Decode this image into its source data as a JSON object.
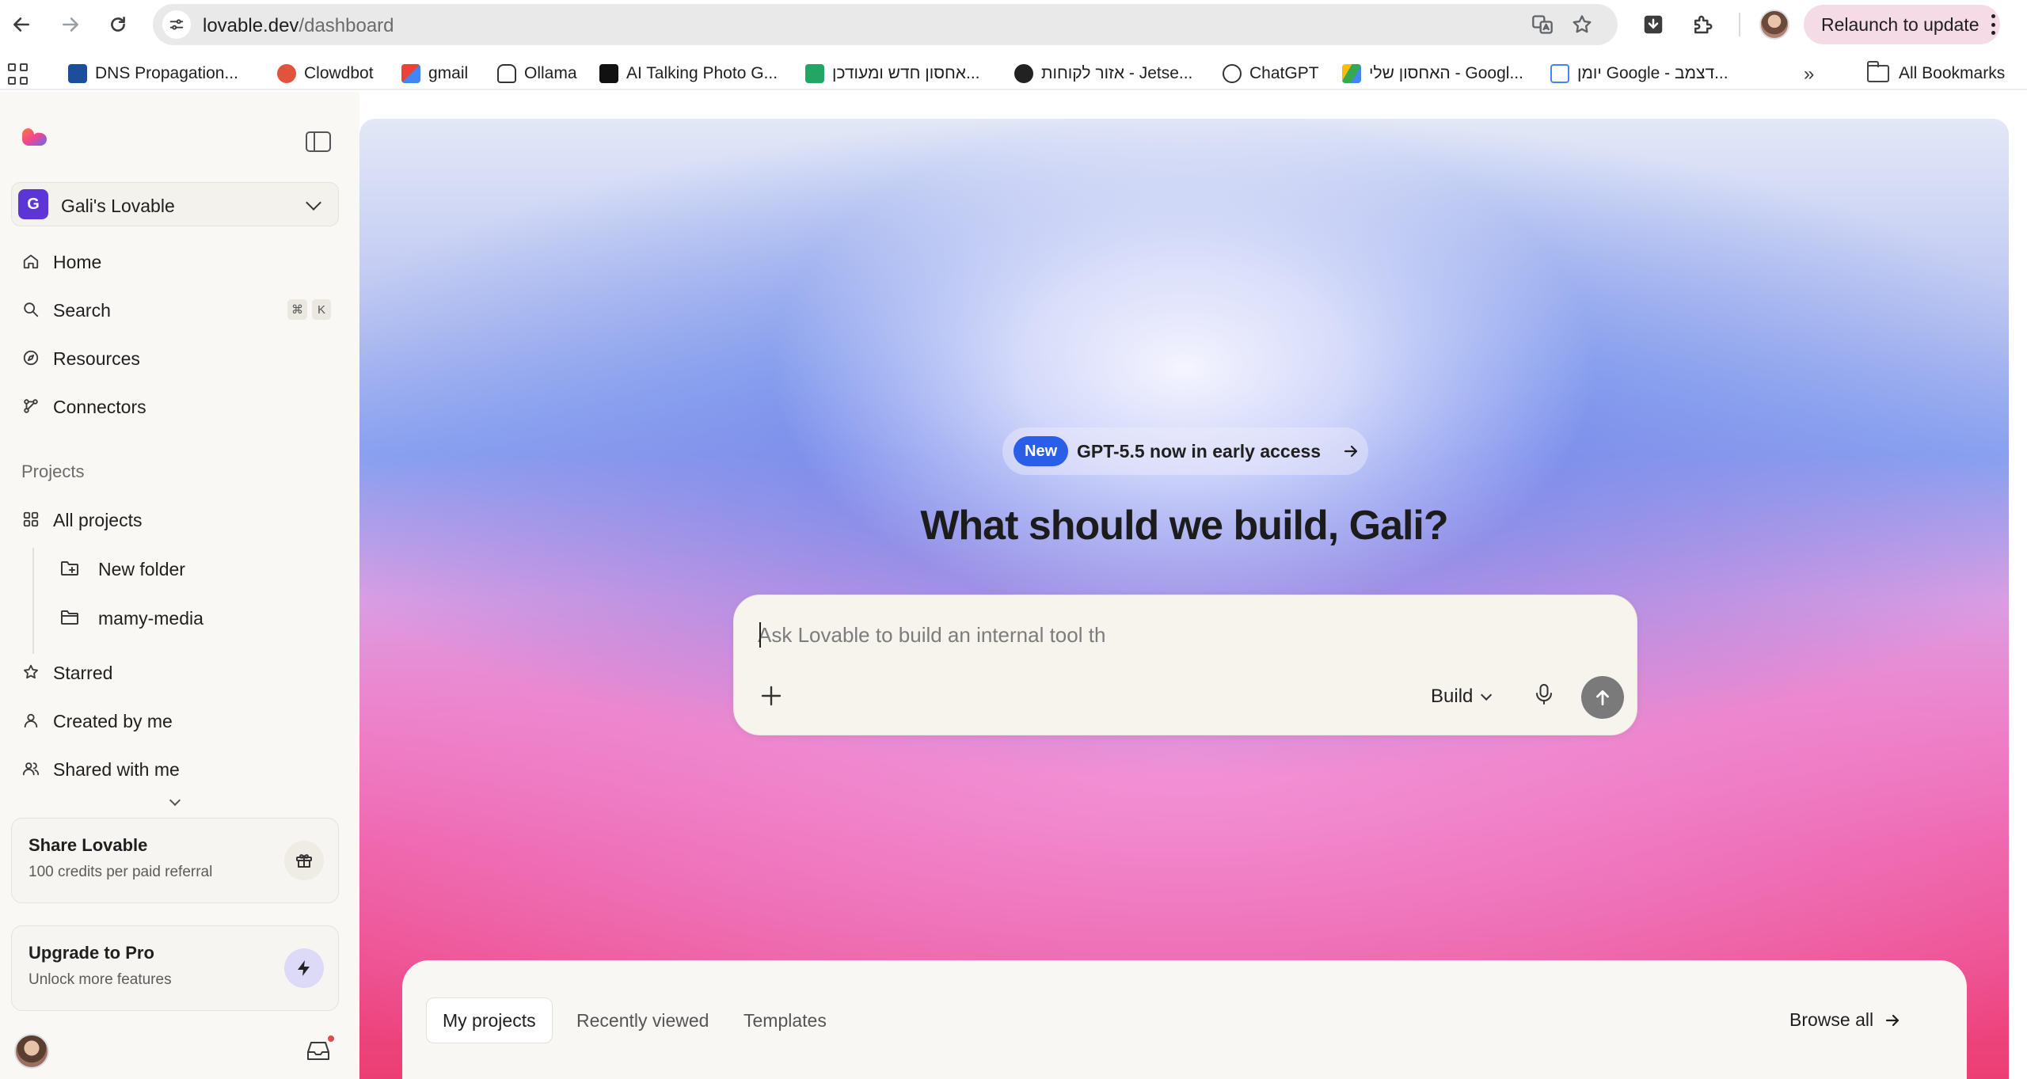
{
  "browser": {
    "url_host": "lovable.dev",
    "url_path": "/dashboard",
    "relaunch_label": "Relaunch to update"
  },
  "bookmarks": {
    "items": [
      {
        "label": "DNS Propagation..."
      },
      {
        "label": "Clowdbot"
      },
      {
        "label": "gmail"
      },
      {
        "label": "Ollama"
      },
      {
        "label": "AI Talking Photo G..."
      },
      {
        "label": "אחסון חדש ומעודכן..."
      },
      {
        "label": "אזור לקוחות - Jetse..."
      },
      {
        "label": "ChatGPT"
      },
      {
        "label": "האחסון שלי - Googl..."
      },
      {
        "label": "יומן Google - דצמב..."
      }
    ],
    "more": "»",
    "all_label": "All Bookmarks"
  },
  "sidebar": {
    "workspace": {
      "initial": "G",
      "name": "Gali's Lovable"
    },
    "nav": {
      "home": "Home",
      "search": "Search",
      "search_kbd_1": "⌘",
      "search_kbd_2": "K",
      "resources": "Resources",
      "connectors": "Connectors"
    },
    "projects_heading": "Projects",
    "projects": {
      "all": "All projects",
      "folders": [
        "New folder",
        "mamy-media"
      ],
      "starred": "Starred",
      "created": "Created by me",
      "shared": "Shared with me"
    },
    "share_card": {
      "title": "Share Lovable",
      "subtitle": "100 credits per paid referral"
    },
    "upgrade_card": {
      "title": "Upgrade to Pro",
      "subtitle": "Unlock more features"
    }
  },
  "hero": {
    "badge_tag": "New",
    "badge_text": "GPT-5.5 now in early access",
    "title": "What should we build, Gali?",
    "prompt_placeholder": "Ask Lovable to build an internal tool th",
    "mode": "Build"
  },
  "projects_panel": {
    "tabs": [
      "My projects",
      "Recently viewed",
      "Templates"
    ],
    "browse_all": "Browse all"
  },
  "colors": {
    "accent_blue": "#2b5ee8",
    "workspace_purple": "#5b35d5",
    "relaunch_pink": "#f5dbe6"
  }
}
